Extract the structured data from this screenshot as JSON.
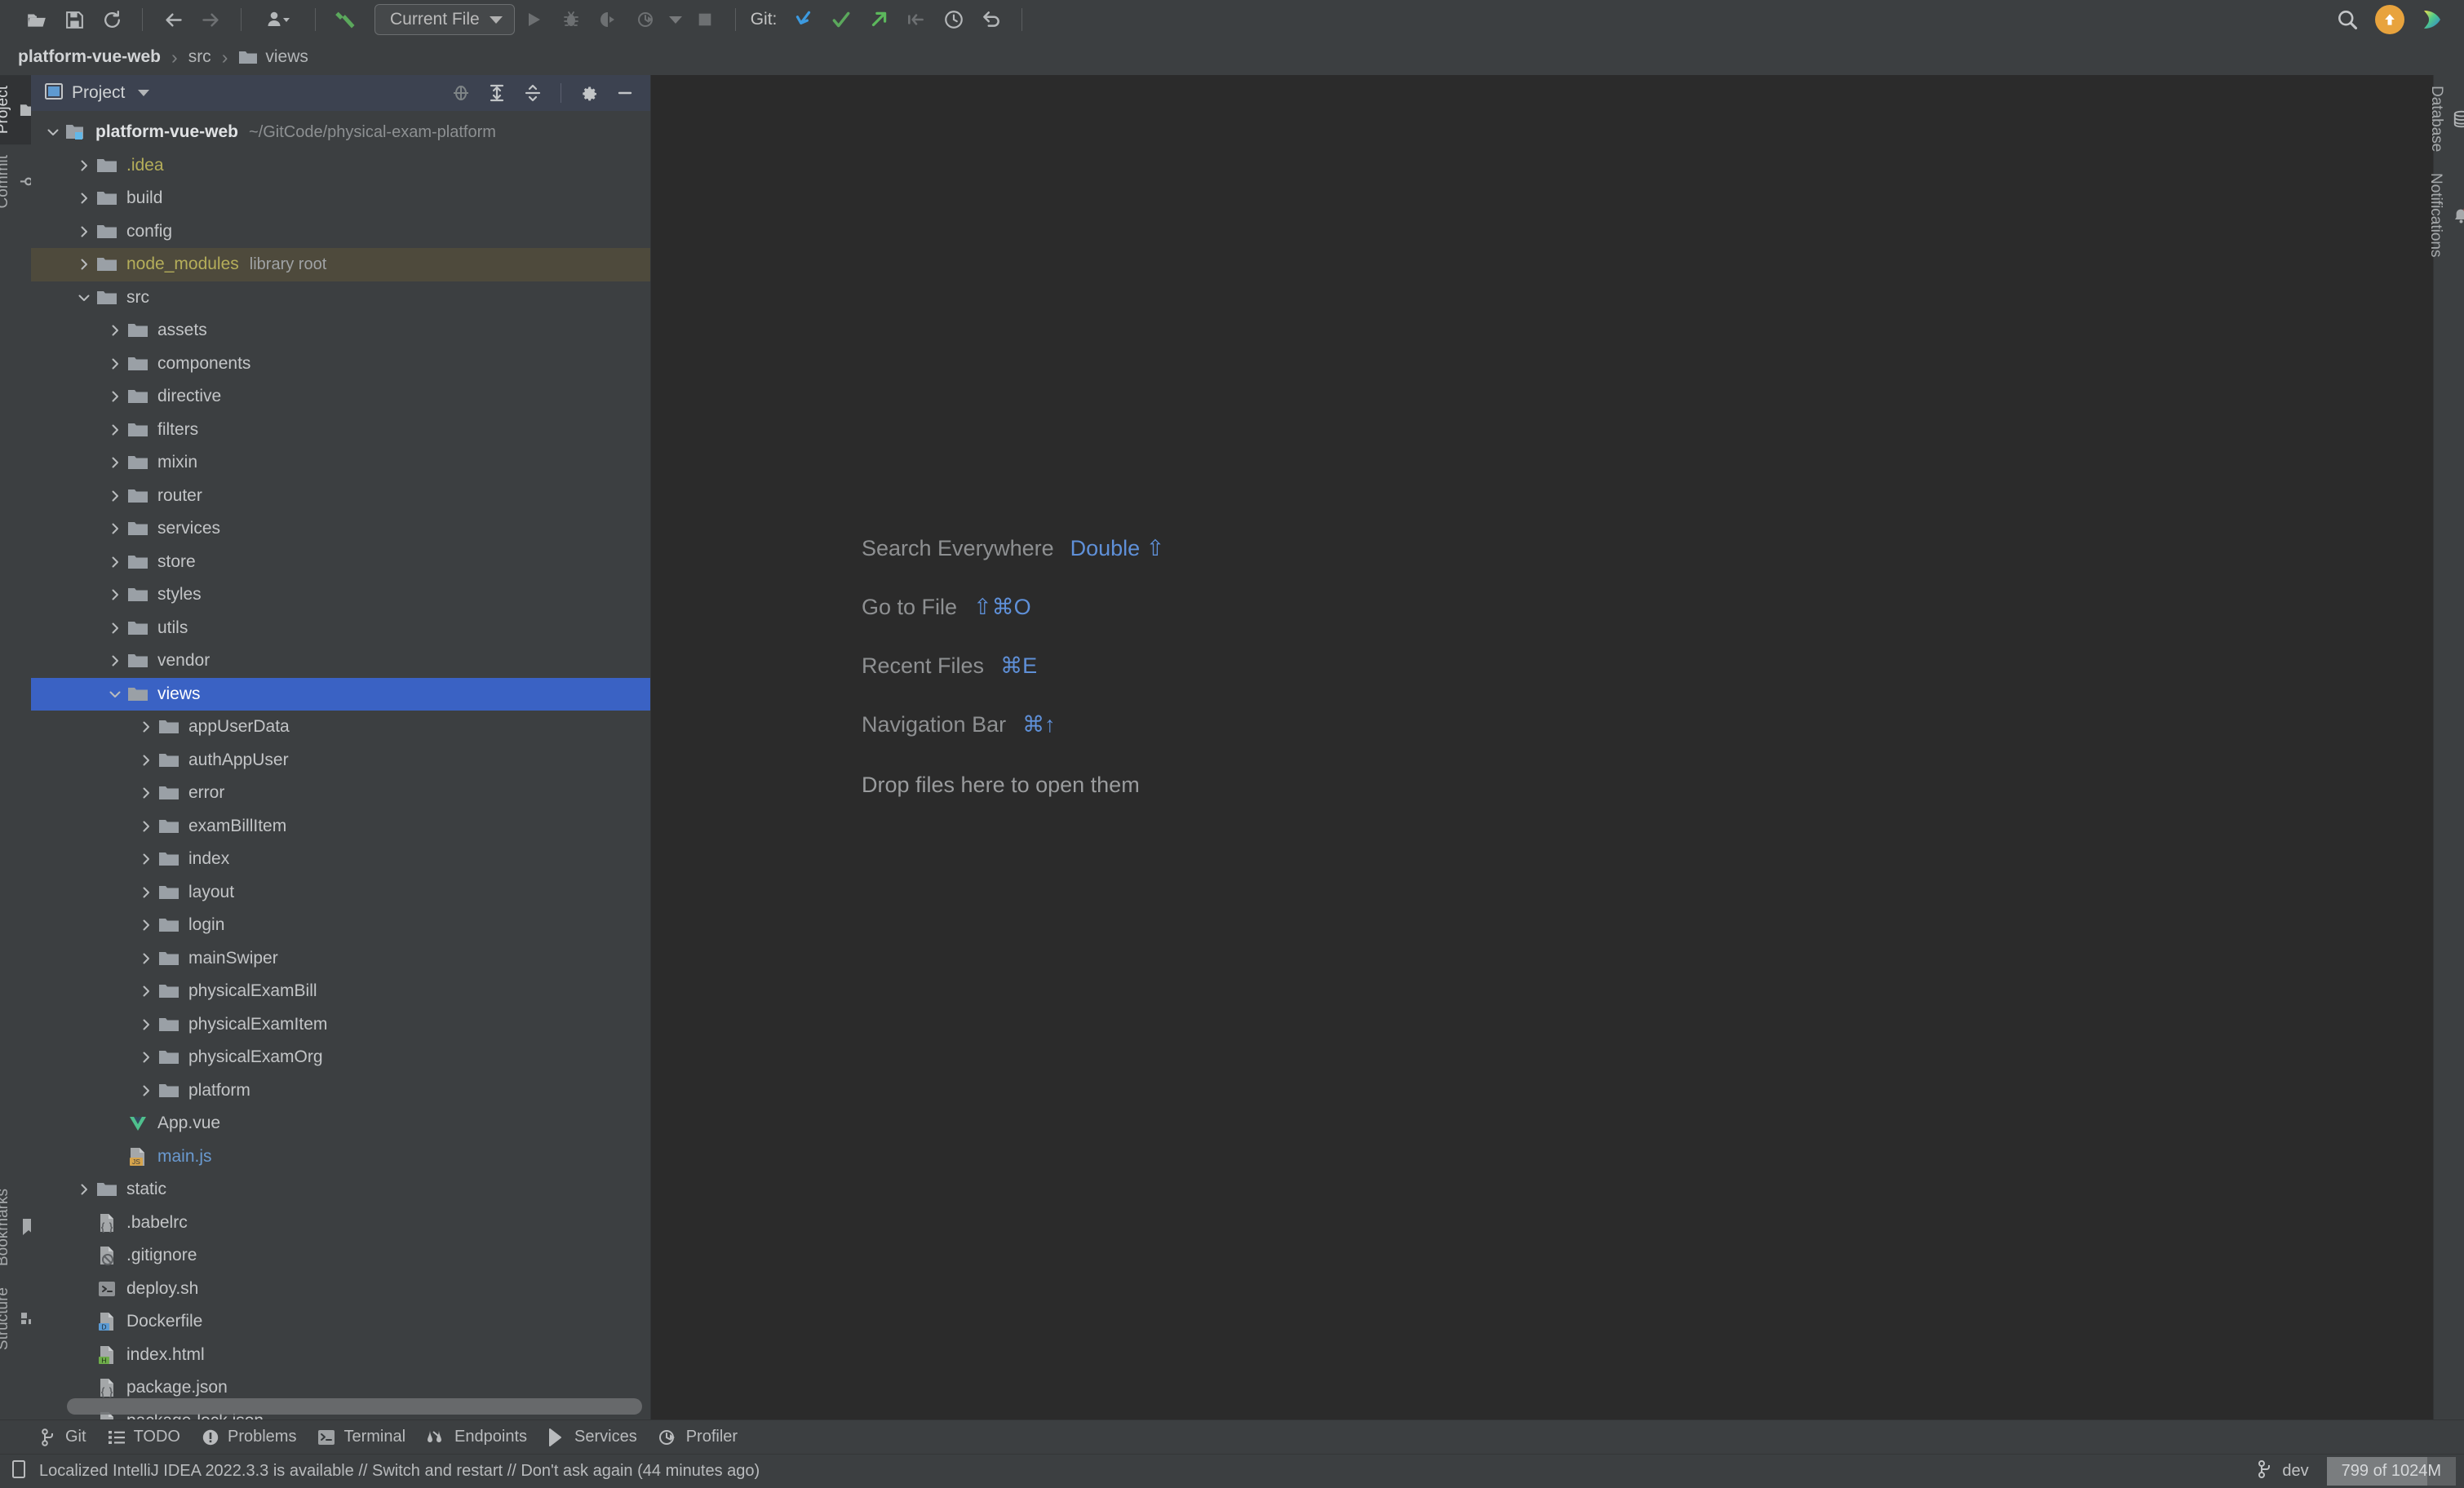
{
  "toolbar": {
    "icons_left": [
      "open-folder-icon",
      "save-icon",
      "sync-icon",
      "back-arrow-icon",
      "forward-arrow-icon",
      "user-profile-icon",
      "build-hammer-icon"
    ],
    "run_config": "Current File",
    "icons_run": [
      "run-icon",
      "debug-icon",
      "run-coverage-icon",
      "profile-icon",
      "stop-icon"
    ],
    "git_label": "Git:",
    "icons_git": [
      "update-project-icon",
      "commit-icon",
      "push-icon",
      "pull-request-icon",
      "history-icon",
      "rollback-icon"
    ],
    "icons_right": [
      "search-icon",
      "update-available-icon",
      "ide-feature-icon"
    ]
  },
  "breadcrumb": {
    "project": "platform-vue-web",
    "src": "src",
    "views": "views",
    "separator": "›"
  },
  "left_strip": {
    "items": [
      {
        "label": "Project",
        "icon": "project-folder-icon",
        "active": true
      },
      {
        "label": "Commit",
        "icon": "commit-circle-icon",
        "active": false
      }
    ],
    "bottom_items": [
      {
        "label": "Bookmarks",
        "icon": "bookmark-icon",
        "active": false
      },
      {
        "label": "Structure",
        "icon": "structure-icon",
        "active": false
      }
    ]
  },
  "right_strip": {
    "items": [
      {
        "label": "Database",
        "icon": "database-icon",
        "active": false
      },
      {
        "label": "Notifications",
        "icon": "bell-icon",
        "active": false,
        "badge": true
      }
    ]
  },
  "project_panel": {
    "title": "Project",
    "header_icons": [
      "locate-target-icon",
      "expand-all-icon",
      "collapse-all-icon",
      "gear-icon",
      "minimize-icon"
    ],
    "tree": [
      {
        "depth": 0,
        "arrow": "down",
        "icon": "module-icon",
        "label": "platform-vue-web",
        "style": "bold",
        "suffix": "~/GitCode/physical-exam-platform"
      },
      {
        "depth": 1,
        "arrow": "right",
        "icon": "folder-icon",
        "label": ".idea",
        "style": "yellowish"
      },
      {
        "depth": 1,
        "arrow": "right",
        "icon": "folder-icon",
        "label": "build"
      },
      {
        "depth": 1,
        "arrow": "right",
        "icon": "folder-icon",
        "label": "config"
      },
      {
        "depth": 1,
        "arrow": "right",
        "icon": "folder-icon",
        "label": "node_modules",
        "style": "yellowish",
        "suffix": "library root",
        "row": "libroot"
      },
      {
        "depth": 1,
        "arrow": "down",
        "icon": "folder-icon",
        "label": "src"
      },
      {
        "depth": 2,
        "arrow": "right",
        "icon": "folder-icon",
        "label": "assets"
      },
      {
        "depth": 2,
        "arrow": "right",
        "icon": "folder-icon",
        "label": "components"
      },
      {
        "depth": 2,
        "arrow": "right",
        "icon": "folder-icon",
        "label": "directive"
      },
      {
        "depth": 2,
        "arrow": "right",
        "icon": "folder-icon",
        "label": "filters"
      },
      {
        "depth": 2,
        "arrow": "right",
        "icon": "folder-icon",
        "label": "mixin"
      },
      {
        "depth": 2,
        "arrow": "right",
        "icon": "folder-icon",
        "label": "router"
      },
      {
        "depth": 2,
        "arrow": "right",
        "icon": "folder-icon",
        "label": "services"
      },
      {
        "depth": 2,
        "arrow": "right",
        "icon": "folder-icon",
        "label": "store"
      },
      {
        "depth": 2,
        "arrow": "right",
        "icon": "folder-icon",
        "label": "styles"
      },
      {
        "depth": 2,
        "arrow": "right",
        "icon": "folder-icon",
        "label": "utils"
      },
      {
        "depth": 2,
        "arrow": "right",
        "icon": "folder-icon",
        "label": "vendor"
      },
      {
        "depth": 2,
        "arrow": "down",
        "icon": "folder-icon",
        "label": "views",
        "row": "selected"
      },
      {
        "depth": 3,
        "arrow": "right",
        "icon": "folder-icon",
        "label": "appUserData"
      },
      {
        "depth": 3,
        "arrow": "right",
        "icon": "folder-icon",
        "label": "authAppUser"
      },
      {
        "depth": 3,
        "arrow": "right",
        "icon": "folder-icon",
        "label": "error"
      },
      {
        "depth": 3,
        "arrow": "right",
        "icon": "folder-icon",
        "label": "examBillItem"
      },
      {
        "depth": 3,
        "arrow": "right",
        "icon": "folder-icon",
        "label": "index"
      },
      {
        "depth": 3,
        "arrow": "right",
        "icon": "folder-icon",
        "label": "layout"
      },
      {
        "depth": 3,
        "arrow": "right",
        "icon": "folder-icon",
        "label": "login"
      },
      {
        "depth": 3,
        "arrow": "right",
        "icon": "folder-icon",
        "label": "mainSwiper"
      },
      {
        "depth": 3,
        "arrow": "right",
        "icon": "folder-icon",
        "label": "physicalExamBill"
      },
      {
        "depth": 3,
        "arrow": "right",
        "icon": "folder-icon",
        "label": "physicalExamItem"
      },
      {
        "depth": 3,
        "arrow": "right",
        "icon": "folder-icon",
        "label": "physicalExamOrg"
      },
      {
        "depth": 3,
        "arrow": "right",
        "icon": "folder-icon",
        "label": "platform"
      },
      {
        "depth": 2,
        "arrow": "none",
        "icon": "vue-file-icon",
        "label": "App.vue"
      },
      {
        "depth": 2,
        "arrow": "none",
        "icon": "js-file-icon",
        "label": "main.js",
        "style": "blue"
      },
      {
        "depth": 1,
        "arrow": "right",
        "icon": "folder-icon",
        "label": "static"
      },
      {
        "depth": 1,
        "arrow": "none",
        "icon": "json-file-icon",
        "label": ".babelrc"
      },
      {
        "depth": 1,
        "arrow": "none",
        "icon": "gitignore-file-icon",
        "label": ".gitignore"
      },
      {
        "depth": 1,
        "arrow": "none",
        "icon": "shell-file-icon",
        "label": "deploy.sh"
      },
      {
        "depth": 1,
        "arrow": "none",
        "icon": "docker-file-icon",
        "label": "Dockerfile"
      },
      {
        "depth": 1,
        "arrow": "none",
        "icon": "html-file-icon",
        "label": "index.html"
      },
      {
        "depth": 1,
        "arrow": "none",
        "icon": "json-file-icon",
        "label": "package.json"
      },
      {
        "depth": 1,
        "arrow": "none",
        "icon": "json-file-icon",
        "label": "package-lock.json"
      }
    ]
  },
  "editor": {
    "hints": [
      {
        "label": "Search Everywhere",
        "shortcut": "Double ⇧"
      },
      {
        "label": "Go to File",
        "shortcut": "⇧⌘O"
      },
      {
        "label": "Recent Files",
        "shortcut": "⌘E"
      },
      {
        "label": "Navigation Bar",
        "shortcut": "⌘↑"
      }
    ],
    "drop_hint": "Drop files here to open them"
  },
  "bottom_tool_window_bar": {
    "items": [
      {
        "label": "Git",
        "icon": "git-branch-icon"
      },
      {
        "label": "TODO",
        "icon": "todo-list-icon"
      },
      {
        "label": "Problems",
        "icon": "problems-icon"
      },
      {
        "label": "Terminal",
        "icon": "terminal-icon"
      },
      {
        "label": "Endpoints",
        "icon": "endpoints-icon"
      },
      {
        "label": "Services",
        "icon": "services-icon"
      },
      {
        "label": "Profiler",
        "icon": "profiler-icon"
      }
    ]
  },
  "status_bar": {
    "message": "Localized IntelliJ IDEA 2022.3.3 is available // Switch and restart // Don't ask again (44 minutes ago)",
    "message_icon": "notification-event-log-icon",
    "branch": "dev",
    "branch_icon": "git-branch-icon",
    "memory": "799 of 1024M"
  },
  "colors": {
    "editor_bg": "#2b2b2b",
    "panel_bg": "#3c3f41",
    "selection_blue": "#3a62c4",
    "library_root": "#4e4a3c",
    "accent_link": "#5f90d8",
    "folder_gray": "#9aa0a6",
    "update_orange": "#e8a33d"
  }
}
